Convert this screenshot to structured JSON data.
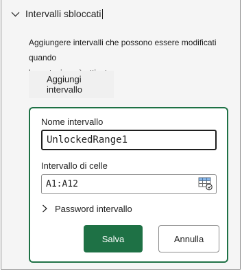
{
  "section": {
    "title": "Intervalli sbloccati",
    "expand_icon": "chevron-down-icon"
  },
  "description": {
    "line1": "Aggiungere intervalli che possono essere modificati quando",
    "line2": "la protezione è attivata."
  },
  "add_range_label": "Aggiungi intervallo",
  "form": {
    "name_label": "Nome intervallo",
    "name_value": "UnlockedRange1",
    "cells_label": "Intervallo di celle",
    "cells_value": "A1:A12",
    "picker_icon": "range-select-icon",
    "password_label": "Password intervallo",
    "password_icon": "chevron-right-icon",
    "save_label": "Salva",
    "cancel_label": "Annulla"
  },
  "colors": {
    "accent": "#1e7145",
    "panel_bg": "#f5f5f5",
    "text": "#1f1f1f"
  }
}
